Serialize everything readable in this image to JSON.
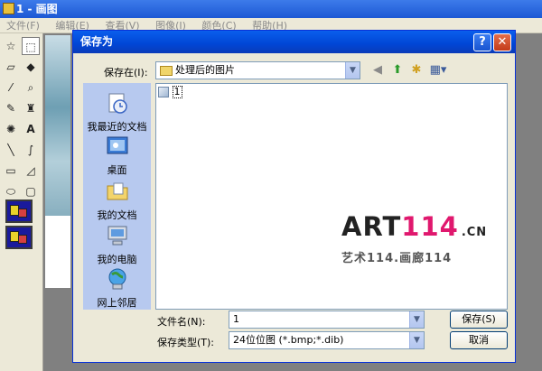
{
  "paint": {
    "title": "1 - 画图",
    "menu": [
      "文件(F)",
      "编辑(E)",
      "查看(V)",
      "图像(I)",
      "颜色(C)",
      "帮助(H)"
    ]
  },
  "dialog": {
    "title": "保存为",
    "help_label": "?",
    "close_label": "✕",
    "save_in_label": "保存在(I):",
    "save_in_value": "处理后的图片",
    "places": [
      "我最近的文档",
      "桌面",
      "我的文档",
      "我的电脑",
      "网上邻居"
    ],
    "files": [
      {
        "name": "1"
      }
    ],
    "filename_label": "文件名(N):",
    "filename_value": "1",
    "filetype_label": "保存类型(T):",
    "filetype_value": "24位位图 (*.bmp;*.dib)",
    "save_button": "保存(S)",
    "cancel_button": "取消"
  },
  "watermark": {
    "art": "ART",
    "num": "114",
    "cn": ".CN",
    "sub": "艺术114.画廊114"
  },
  "colors": {
    "accent": "#0046d5",
    "watermark_pink": "#e0186e"
  }
}
